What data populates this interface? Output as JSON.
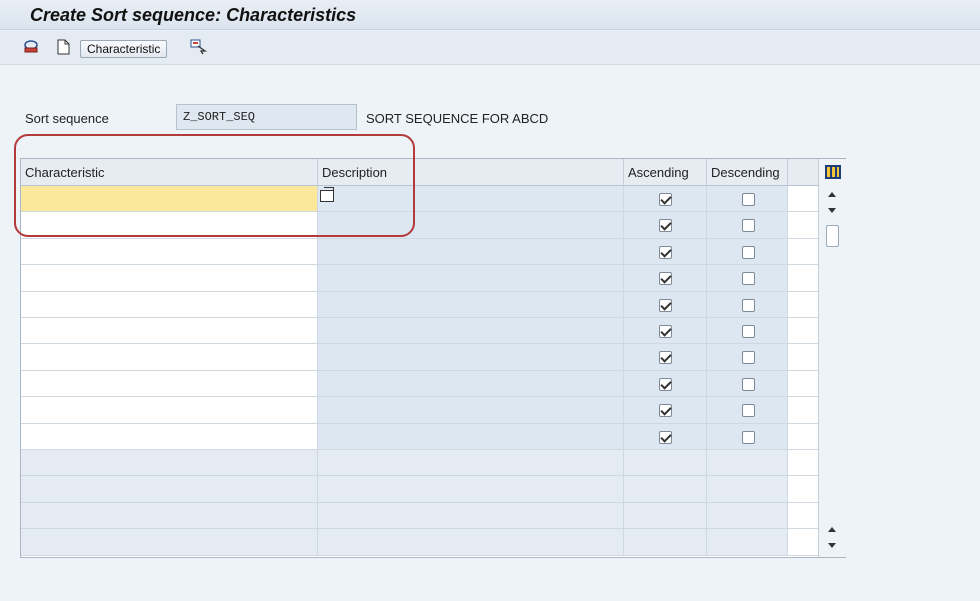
{
  "window": {
    "title": "Create Sort sequence: Characteristics"
  },
  "toolbar": {
    "icons": [
      "display-icon",
      "new-document-icon",
      "select-icon"
    ],
    "characteristic_button": "Characteristic"
  },
  "header_fields": {
    "sort_sequence_label": "Sort sequence",
    "sort_sequence_value": "Z_SORT_SEQ",
    "sort_sequence_description": "SORT SEQUENCE FOR ABCD"
  },
  "table": {
    "columns": [
      "Characteristic",
      "Description",
      "Ascending",
      "Descending"
    ],
    "rows": [
      {
        "characteristic": "",
        "description": "",
        "ascending": true,
        "descending": false
      },
      {
        "characteristic": "",
        "description": "",
        "ascending": true,
        "descending": false
      },
      {
        "characteristic": "",
        "description": "",
        "ascending": true,
        "descending": false
      },
      {
        "characteristic": "",
        "description": "",
        "ascending": true,
        "descending": false
      },
      {
        "characteristic": "",
        "description": "",
        "ascending": true,
        "descending": false
      },
      {
        "characteristic": "",
        "description": "",
        "ascending": true,
        "descending": false
      },
      {
        "characteristic": "",
        "description": "",
        "ascending": true,
        "descending": false
      },
      {
        "characteristic": "",
        "description": "",
        "ascending": true,
        "descending": false
      },
      {
        "characteristic": "",
        "description": "",
        "ascending": true,
        "descending": false
      },
      {
        "characteristic": "",
        "description": "",
        "ascending": true,
        "descending": false
      }
    ],
    "empty_rows": 4
  },
  "colors": {
    "active_cell": "#fce89a",
    "highlight_ring": "#b23a3a"
  }
}
